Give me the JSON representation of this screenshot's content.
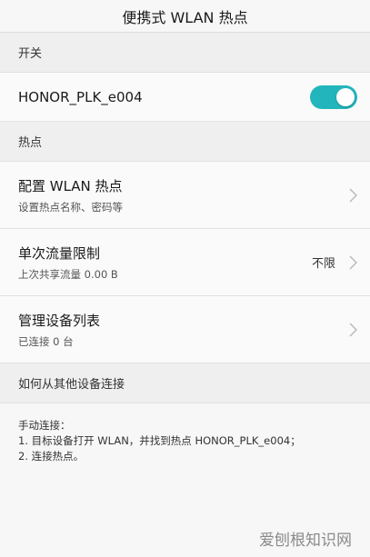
{
  "header": {
    "title": "便携式 WLAN 热点"
  },
  "switch_section": {
    "title": "开关",
    "hotspot_name": "HONOR_PLK_e004",
    "toggle_on": true,
    "accent_color": "#22b6bc"
  },
  "hotspot_section": {
    "title": "热点",
    "items": [
      {
        "title": "配置 WLAN 热点",
        "subtitle": "设置热点名称、密码等",
        "value": ""
      },
      {
        "title": "单次流量限制",
        "subtitle": "上次共享流量 0.00 B",
        "value": "不限"
      },
      {
        "title": "管理设备列表",
        "subtitle": "已连接 0 台",
        "value": ""
      }
    ]
  },
  "connect_section": {
    "title": "如何从其他设备连接",
    "lines": [
      "手动连接：",
      "1. 目标设备打开 WLAN，并找到热点 HONOR_PLK_e004；",
      "2. 连接热点。"
    ]
  },
  "watermark": {
    "text": "爱刨根知识网"
  },
  "icons": {
    "chevron": "chevron-right-icon"
  }
}
